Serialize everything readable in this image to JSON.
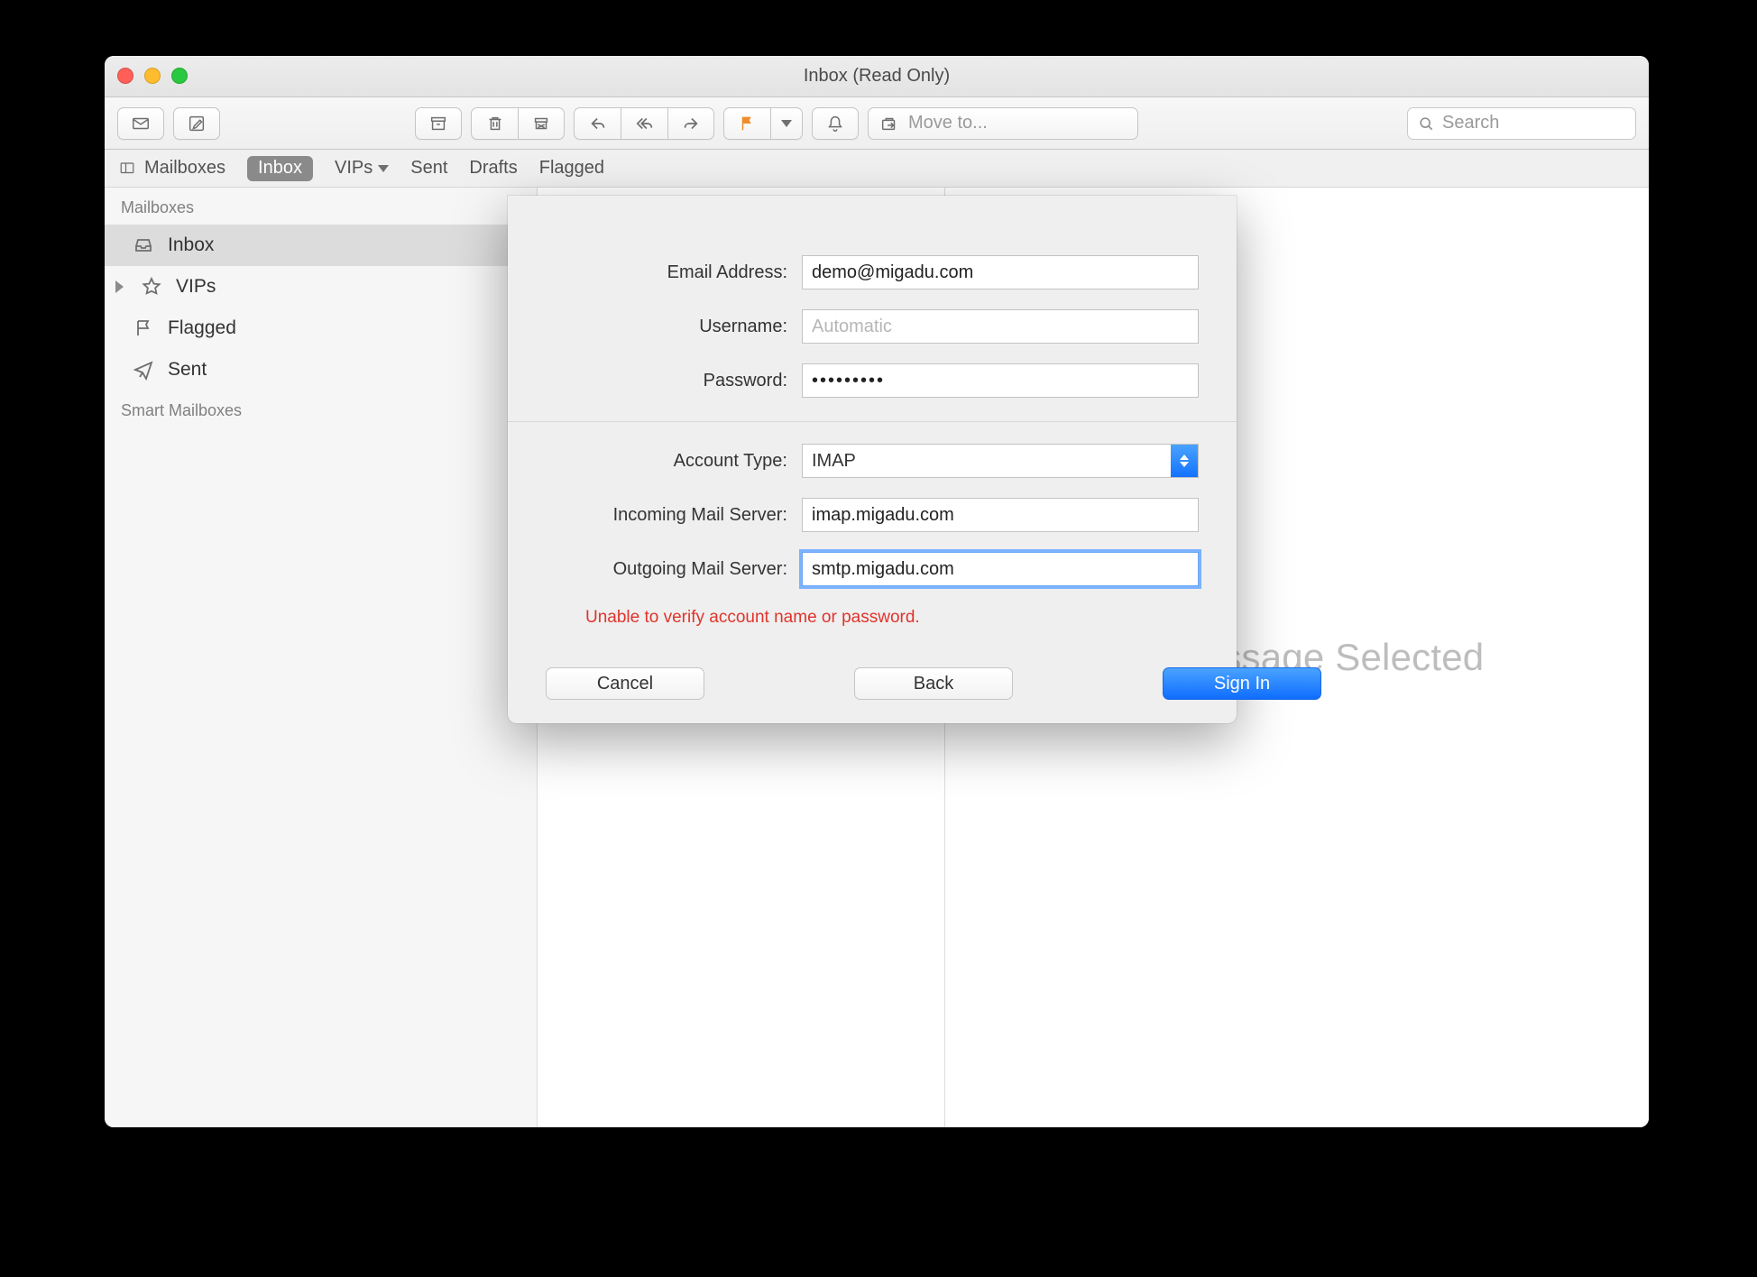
{
  "window": {
    "title": "Inbox (Read Only)"
  },
  "toolbar": {
    "moveto_placeholder": "Move to...",
    "search_placeholder": "Search"
  },
  "favorites": {
    "mailboxes": "Mailboxes",
    "tabs": [
      "Inbox",
      "VIPs",
      "Sent",
      "Drafts",
      "Flagged"
    ]
  },
  "sidebar": {
    "section1": "Mailboxes",
    "items": [
      {
        "label": "Inbox"
      },
      {
        "label": "VIPs"
      },
      {
        "label": "Flagged"
      },
      {
        "label": "Sent"
      }
    ],
    "section2": "Smart Mailboxes"
  },
  "readpane": {
    "empty": "No Message Selected"
  },
  "dialog": {
    "labels": {
      "email": "Email Address:",
      "username": "Username:",
      "password": "Password:",
      "account_type": "Account Type:",
      "incoming": "Incoming Mail Server:",
      "outgoing": "Outgoing Mail Server:"
    },
    "values": {
      "email": "demo@migadu.com",
      "username_placeholder": "Automatic",
      "password": "•••••••••",
      "account_type": "IMAP",
      "incoming": "imap.migadu.com",
      "outgoing": "smtp.migadu.com"
    },
    "error": "Unable to verify account name or password.",
    "buttons": {
      "cancel": "Cancel",
      "back": "Back",
      "signin": "Sign In"
    }
  }
}
